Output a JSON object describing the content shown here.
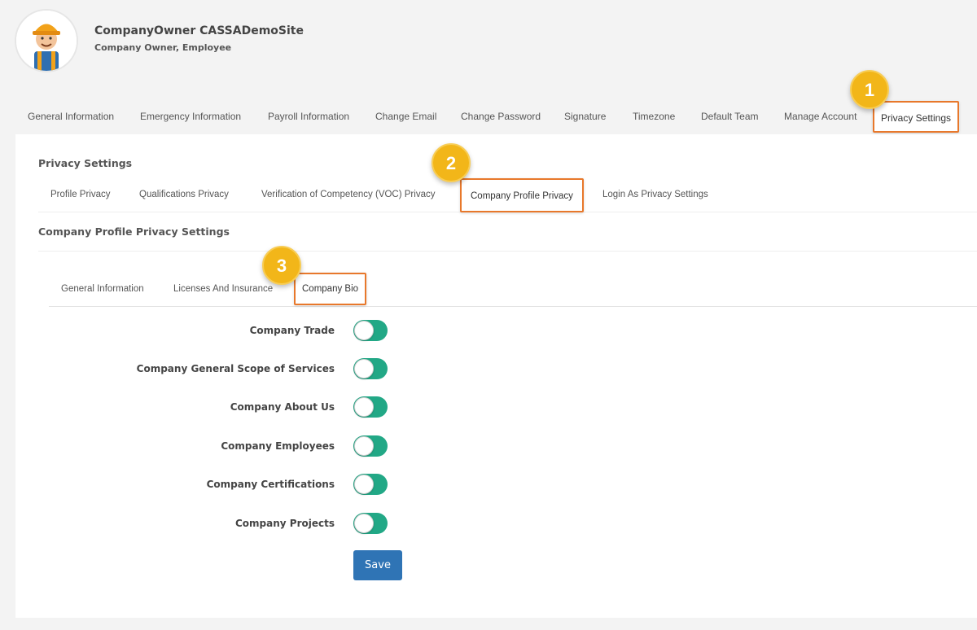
{
  "profile": {
    "name": "CompanyOwner CASSADemoSite",
    "role": "Company Owner, Employee",
    "avatar_icon": "construction-worker-avatar-icon"
  },
  "top_tabs": [
    {
      "label": "General Information",
      "active": false
    },
    {
      "label": "Emergency Information",
      "active": false
    },
    {
      "label": "Payroll Information",
      "active": false
    },
    {
      "label": "Change Email",
      "active": false
    },
    {
      "label": "Change Password",
      "active": false
    },
    {
      "label": "Signature",
      "active": false
    },
    {
      "label": "Timezone",
      "active": false
    },
    {
      "label": "Default Team",
      "active": false
    },
    {
      "label": "Manage Account",
      "active": false
    },
    {
      "label": "Privacy Settings",
      "active": true
    }
  ],
  "privacy": {
    "title": "Privacy Settings",
    "sub_tabs": [
      {
        "label": "Profile Privacy",
        "active": false
      },
      {
        "label": "Qualifications Privacy",
        "active": false
      },
      {
        "label": "Verification of Competency (VOC) Privacy",
        "active": false
      },
      {
        "label": "Company Profile Privacy",
        "active": true
      },
      {
        "label": "Login As Privacy Settings",
        "active": false
      }
    ]
  },
  "company_profile": {
    "title": "Company Profile Privacy Settings",
    "inner_tabs": [
      {
        "label": "General Information",
        "active": false
      },
      {
        "label": "Licenses And Insurance",
        "active": false
      },
      {
        "label": "Company Bio",
        "active": true
      }
    ],
    "settings": [
      {
        "label": "Company Trade",
        "enabled": true
      },
      {
        "label": "Company General Scope of Services",
        "enabled": true
      },
      {
        "label": "Company About Us",
        "enabled": true
      },
      {
        "label": "Company Employees",
        "enabled": true
      },
      {
        "label": "Company Certifications",
        "enabled": true
      },
      {
        "label": "Company Projects",
        "enabled": true
      }
    ],
    "save_label": "Save"
  },
  "callouts": [
    "1",
    "2",
    "3"
  ],
  "colors": {
    "accent_outline": "#e8782b",
    "toggle_on": "#22a886",
    "save_button": "#2f74b5",
    "callout": "#f2b619"
  }
}
